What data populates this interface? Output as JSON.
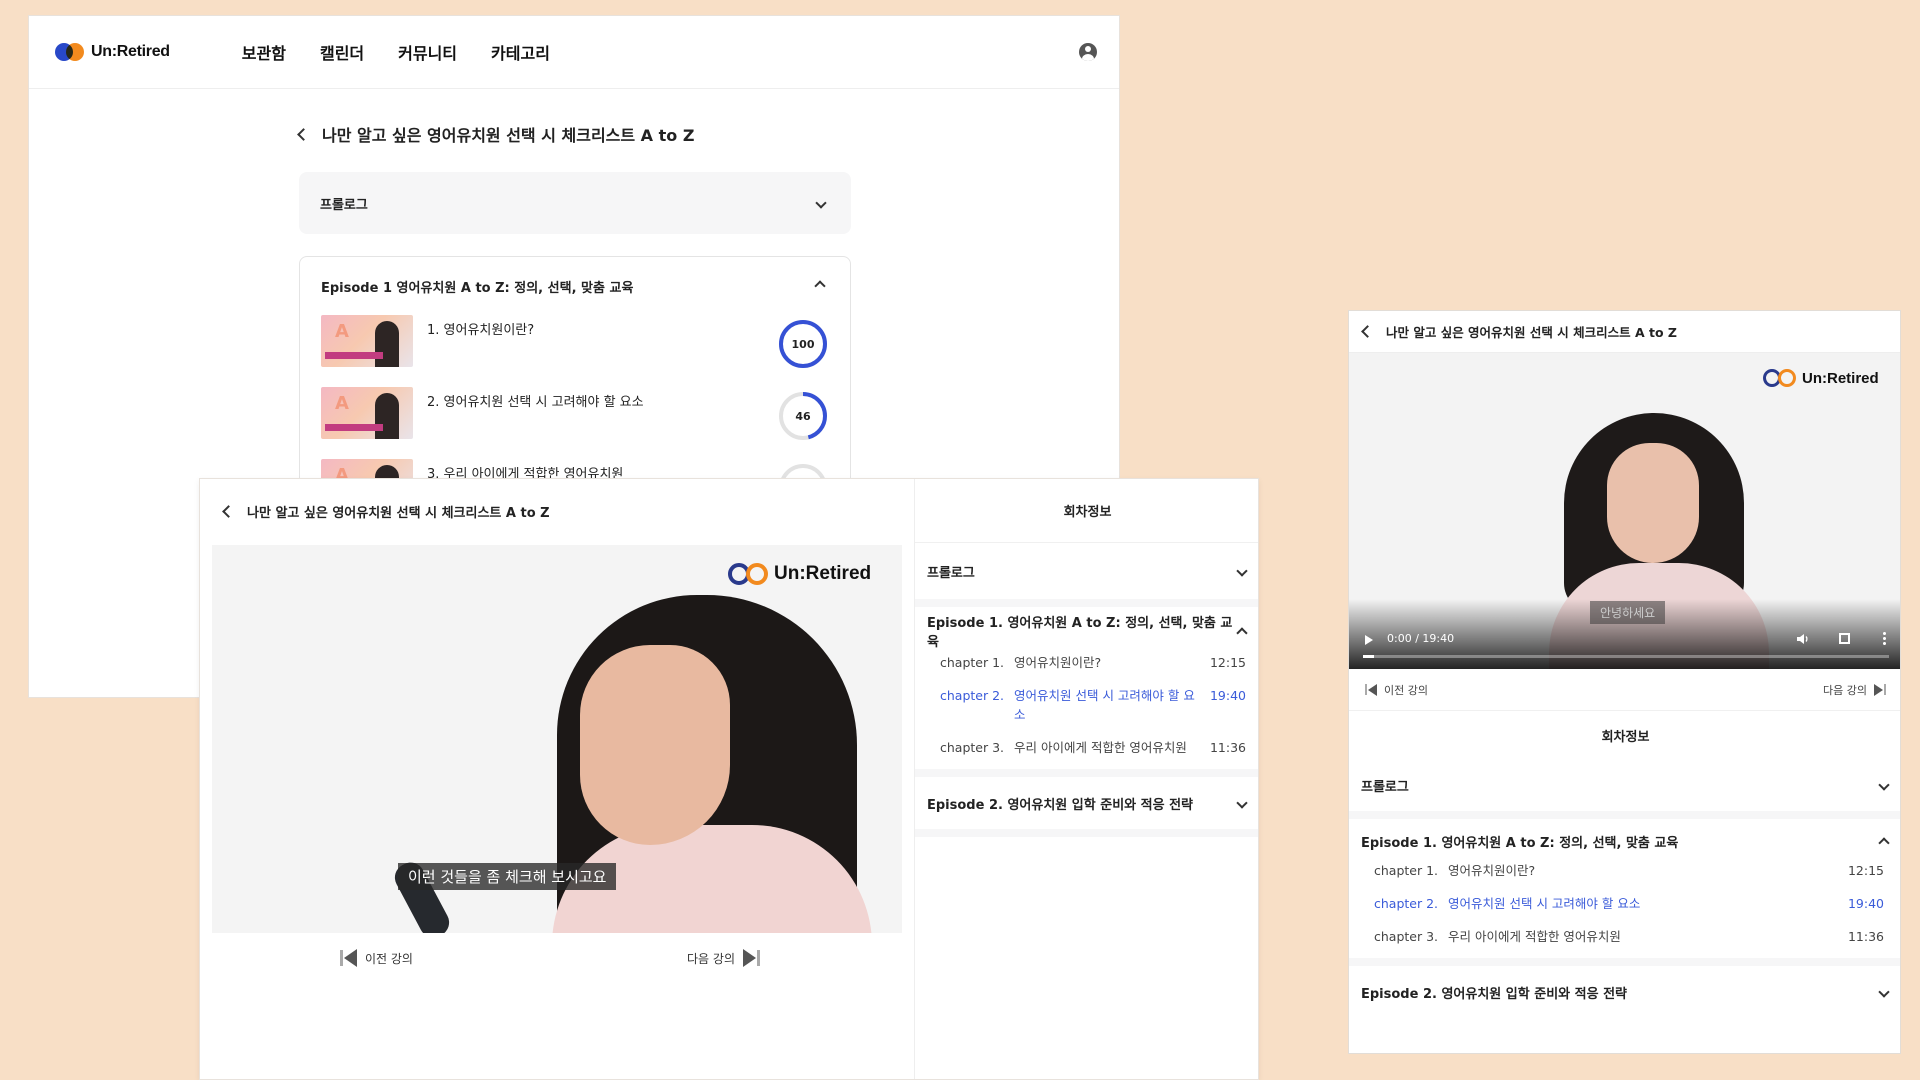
{
  "brand": {
    "name": "Un:Retired"
  },
  "colors": {
    "background": "#F8DFC6",
    "accent": "#3A5BD9",
    "logo_blue": "#2848C8",
    "logo_orange": "#F28A1E"
  },
  "nav": {
    "items": [
      "보관함",
      "캘린더",
      "커뮤니티",
      "카테고리"
    ],
    "profile_icon": "user-circle-icon"
  },
  "course": {
    "title": "나만 알고 싶은 영어유치원 선택 시 체크리스트 A to Z",
    "prologue": "프롤로그",
    "episode1_short": "Episode 1 영어유치원 A to Z: 정의, 선택, 맞춤 교육",
    "episode1": "Episode 1. 영어유치원 A to Z: 정의, 선택, 맞춤 교육",
    "episode2": "Episode 2. 영어유치원 입학 준비와 적응 전략"
  },
  "lessons": [
    {
      "label": "1. 영어유치원이란?",
      "progress": 100
    },
    {
      "label": "2. 영어유치원 선택 시 고려해야 할 요소",
      "progress": 46
    },
    {
      "label": "3. 우리 아이에게 적합한 영어유치원",
      "progress": 0
    }
  ],
  "player": {
    "session_info": "회차정보",
    "prev": "이전 강의",
    "next": "다음 강의",
    "subtitle_main": "이런 것들을 좀 체크해 보시고요",
    "subtitle_mobile": "안녕하세요",
    "time": "0:00 / 19:40",
    "progress": 0.02
  },
  "chapters": [
    {
      "num": "chapter 1.",
      "name": "영어유치원이란?",
      "dur": "12:15",
      "active": false
    },
    {
      "num": "chapter 2.",
      "name": "영어유치원 선택 시 고려해야 할 요소",
      "dur": "19:40",
      "active": true
    },
    {
      "num": "chapter 3.",
      "name": "우리 아이에게 적합한 영어유치원",
      "dur": "11:36",
      "active": false
    }
  ]
}
